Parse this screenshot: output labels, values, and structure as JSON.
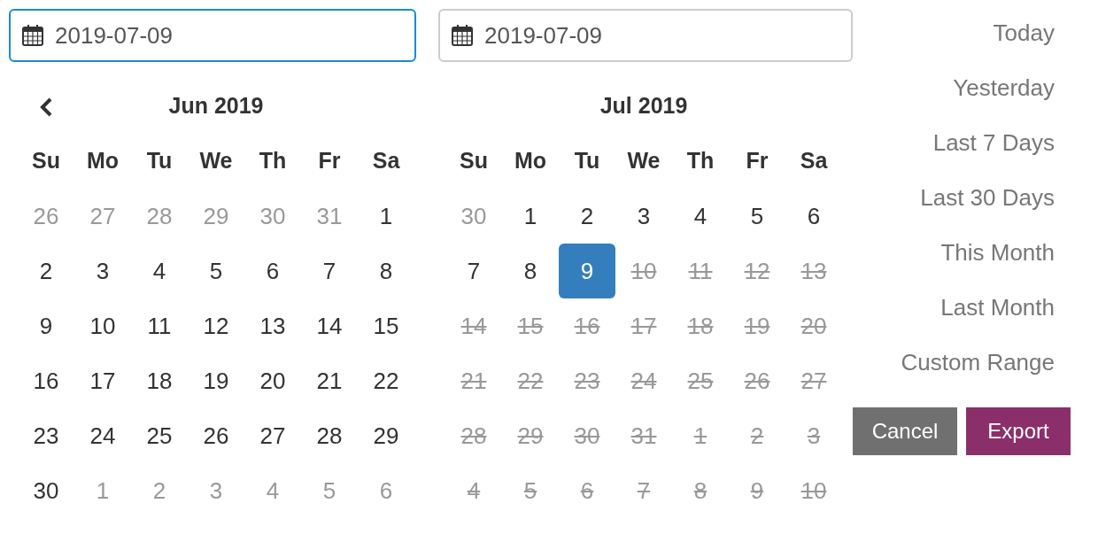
{
  "start_field": {
    "value": "2019-07-09",
    "focused": true
  },
  "end_field": {
    "value": "2019-07-09",
    "focused": false
  },
  "calendars": [
    {
      "month": "Jun 2019",
      "prev_button": true,
      "weekdays": [
        "Su",
        "Mo",
        "Tu",
        "We",
        "Th",
        "Fr",
        "Sa"
      ],
      "days": [
        {
          "d": "26",
          "kind": "off",
          "selected": false
        },
        {
          "d": "27",
          "kind": "off",
          "selected": false
        },
        {
          "d": "28",
          "kind": "off",
          "selected": false
        },
        {
          "d": "29",
          "kind": "off",
          "selected": false
        },
        {
          "d": "30",
          "kind": "off",
          "selected": false
        },
        {
          "d": "31",
          "kind": "off",
          "selected": false
        },
        {
          "d": "1",
          "kind": "normal",
          "selected": false
        },
        {
          "d": "2",
          "kind": "normal",
          "selected": false
        },
        {
          "d": "3",
          "kind": "normal",
          "selected": false
        },
        {
          "d": "4",
          "kind": "normal",
          "selected": false
        },
        {
          "d": "5",
          "kind": "normal",
          "selected": false
        },
        {
          "d": "6",
          "kind": "normal",
          "selected": false
        },
        {
          "d": "7",
          "kind": "normal",
          "selected": false
        },
        {
          "d": "8",
          "kind": "normal",
          "selected": false
        },
        {
          "d": "9",
          "kind": "normal",
          "selected": false
        },
        {
          "d": "10",
          "kind": "normal",
          "selected": false
        },
        {
          "d": "11",
          "kind": "normal",
          "selected": false
        },
        {
          "d": "12",
          "kind": "normal",
          "selected": false
        },
        {
          "d": "13",
          "kind": "normal",
          "selected": false
        },
        {
          "d": "14",
          "kind": "normal",
          "selected": false
        },
        {
          "d": "15",
          "kind": "normal",
          "selected": false
        },
        {
          "d": "16",
          "kind": "normal",
          "selected": false
        },
        {
          "d": "17",
          "kind": "normal",
          "selected": false
        },
        {
          "d": "18",
          "kind": "normal",
          "selected": false
        },
        {
          "d": "19",
          "kind": "normal",
          "selected": false
        },
        {
          "d": "20",
          "kind": "normal",
          "selected": false
        },
        {
          "d": "21",
          "kind": "normal",
          "selected": false
        },
        {
          "d": "22",
          "kind": "normal",
          "selected": false
        },
        {
          "d": "23",
          "kind": "normal",
          "selected": false
        },
        {
          "d": "24",
          "kind": "normal",
          "selected": false
        },
        {
          "d": "25",
          "kind": "normal",
          "selected": false
        },
        {
          "d": "26",
          "kind": "normal",
          "selected": false
        },
        {
          "d": "27",
          "kind": "normal",
          "selected": false
        },
        {
          "d": "28",
          "kind": "normal",
          "selected": false
        },
        {
          "d": "29",
          "kind": "normal",
          "selected": false
        },
        {
          "d": "30",
          "kind": "normal",
          "selected": false
        },
        {
          "d": "1",
          "kind": "off",
          "selected": false
        },
        {
          "d": "2",
          "kind": "off",
          "selected": false
        },
        {
          "d": "3",
          "kind": "off",
          "selected": false
        },
        {
          "d": "4",
          "kind": "off",
          "selected": false
        },
        {
          "d": "5",
          "kind": "off",
          "selected": false
        },
        {
          "d": "6",
          "kind": "off",
          "selected": false
        }
      ]
    },
    {
      "month": "Jul 2019",
      "prev_button": false,
      "weekdays": [
        "Su",
        "Mo",
        "Tu",
        "We",
        "Th",
        "Fr",
        "Sa"
      ],
      "days": [
        {
          "d": "30",
          "kind": "off",
          "selected": false
        },
        {
          "d": "1",
          "kind": "normal",
          "selected": false
        },
        {
          "d": "2",
          "kind": "normal",
          "selected": false
        },
        {
          "d": "3",
          "kind": "normal",
          "selected": false
        },
        {
          "d": "4",
          "kind": "normal",
          "selected": false
        },
        {
          "d": "5",
          "kind": "normal",
          "selected": false
        },
        {
          "d": "6",
          "kind": "normal",
          "selected": false
        },
        {
          "d": "7",
          "kind": "normal",
          "selected": false
        },
        {
          "d": "8",
          "kind": "normal",
          "selected": false
        },
        {
          "d": "9",
          "kind": "normal",
          "selected": true
        },
        {
          "d": "10",
          "kind": "disabled",
          "selected": false
        },
        {
          "d": "11",
          "kind": "disabled",
          "selected": false
        },
        {
          "d": "12",
          "kind": "disabled",
          "selected": false
        },
        {
          "d": "13",
          "kind": "disabled",
          "selected": false
        },
        {
          "d": "14",
          "kind": "disabled",
          "selected": false
        },
        {
          "d": "15",
          "kind": "disabled",
          "selected": false
        },
        {
          "d": "16",
          "kind": "disabled",
          "selected": false
        },
        {
          "d": "17",
          "kind": "disabled",
          "selected": false
        },
        {
          "d": "18",
          "kind": "disabled",
          "selected": false
        },
        {
          "d": "19",
          "kind": "disabled",
          "selected": false
        },
        {
          "d": "20",
          "kind": "disabled",
          "selected": false
        },
        {
          "d": "21",
          "kind": "disabled",
          "selected": false
        },
        {
          "d": "22",
          "kind": "disabled",
          "selected": false
        },
        {
          "d": "23",
          "kind": "disabled",
          "selected": false
        },
        {
          "d": "24",
          "kind": "disabled",
          "selected": false
        },
        {
          "d": "25",
          "kind": "disabled",
          "selected": false
        },
        {
          "d": "26",
          "kind": "disabled",
          "selected": false
        },
        {
          "d": "27",
          "kind": "disabled",
          "selected": false
        },
        {
          "d": "28",
          "kind": "disabled",
          "selected": false
        },
        {
          "d": "29",
          "kind": "disabled",
          "selected": false
        },
        {
          "d": "30",
          "kind": "disabled",
          "selected": false
        },
        {
          "d": "31",
          "kind": "disabled",
          "selected": false
        },
        {
          "d": "1",
          "kind": "disabled",
          "selected": false
        },
        {
          "d": "2",
          "kind": "disabled",
          "selected": false
        },
        {
          "d": "3",
          "kind": "disabled",
          "selected": false
        },
        {
          "d": "4",
          "kind": "disabled",
          "selected": false
        },
        {
          "d": "5",
          "kind": "disabled",
          "selected": false
        },
        {
          "d": "6",
          "kind": "disabled",
          "selected": false
        },
        {
          "d": "7",
          "kind": "disabled",
          "selected": false
        },
        {
          "d": "8",
          "kind": "disabled",
          "selected": false
        },
        {
          "d": "9",
          "kind": "disabled",
          "selected": false
        },
        {
          "d": "10",
          "kind": "disabled",
          "selected": false
        }
      ]
    }
  ],
  "ranges": [
    "Today",
    "Yesterday",
    "Last 7 Days",
    "Last 30 Days",
    "This Month",
    "Last Month",
    "Custom Range"
  ],
  "buttons": [
    {
      "label": "Cancel",
      "kind": "cancel"
    },
    {
      "label": "Export",
      "kind": "primary"
    }
  ]
}
